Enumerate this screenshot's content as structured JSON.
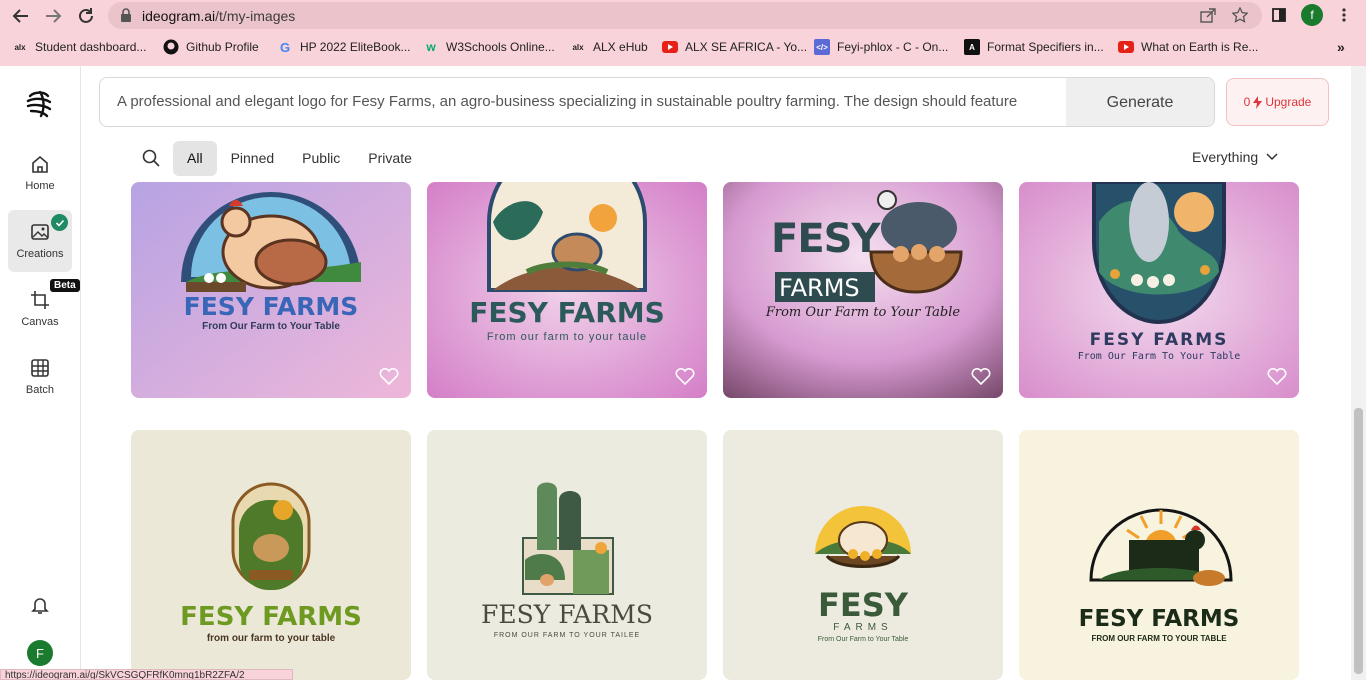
{
  "browser": {
    "url_host": "ideogram.ai",
    "url_path": "/t/my-images",
    "profile_initial": "f",
    "bookmarks": [
      {
        "label": "Student dashboard...",
        "icon": "alx-icon"
      },
      {
        "label": "Github Profile",
        "icon": "github-icon"
      },
      {
        "label": "HP 2022 EliteBook...",
        "icon": "google-icon"
      },
      {
        "label": "W3Schools Online...",
        "icon": "w3schools-icon"
      },
      {
        "label": "ALX eHub",
        "icon": "alx-icon"
      },
      {
        "label": "ALX SE AFRICA - Yo...",
        "icon": "youtube-icon"
      },
      {
        "label": "Feyi-phlox - C - On...",
        "icon": "code-icon"
      },
      {
        "label": "Format Specifiers in...",
        "icon": "geeks-icon"
      },
      {
        "label": "What on Earth is Re...",
        "icon": "youtube-icon"
      }
    ],
    "status_url": "https://ideogram.ai/g/SkVCSGQFRfK0mnq1bR2ZFA/2"
  },
  "sidebar": {
    "items": [
      {
        "label": "Home",
        "icon": "home-icon"
      },
      {
        "label": "Creations",
        "icon": "image-icon"
      },
      {
        "label": "Canvas",
        "icon": "crop-icon",
        "badge": "Beta"
      },
      {
        "label": "Batch",
        "icon": "grid-icon"
      }
    ],
    "avatar_initial": "F"
  },
  "prompt": {
    "text": "A professional and elegant logo for Fesy Farms, an agro-business specializing in sustainable poultry farming. The design should feature",
    "generate_label": "Generate",
    "credits": "0",
    "upgrade_label": "Upgrade"
  },
  "filters": {
    "tabs": [
      "All",
      "Pinned",
      "Public",
      "Private"
    ],
    "active": "All",
    "dropdown_value": "Everything"
  },
  "cards": [
    {
      "title": "FESY FARMS",
      "tagline": "From Our Farm to Your Table"
    },
    {
      "title": "FESY FARMS",
      "tagline": "From our farm to your taule"
    },
    {
      "title": "FESY",
      "title2": "FARMS",
      "tagline": "From Our Farm to Your Table"
    },
    {
      "title": "FESY FARMS",
      "tagline": "From Our Farm To Your Table"
    },
    {
      "title": "FESY FARMS",
      "tagline": "from our farm to your table"
    },
    {
      "title": "FESY FARMS",
      "tagline": "FROM OUR FARM TO YOUR TAILEE"
    },
    {
      "title": "FESY",
      "title2": "FARMS",
      "tagline": "From Our Farm to Your Table"
    },
    {
      "title": "FESY FARMS",
      "tagline": "FROM OUR FARM TO YOUR TABLE"
    }
  ],
  "colors": {
    "chrome_pink": "#f8d3d9",
    "upgrade_red": "#e0343a",
    "check_green": "#1f8a63"
  }
}
